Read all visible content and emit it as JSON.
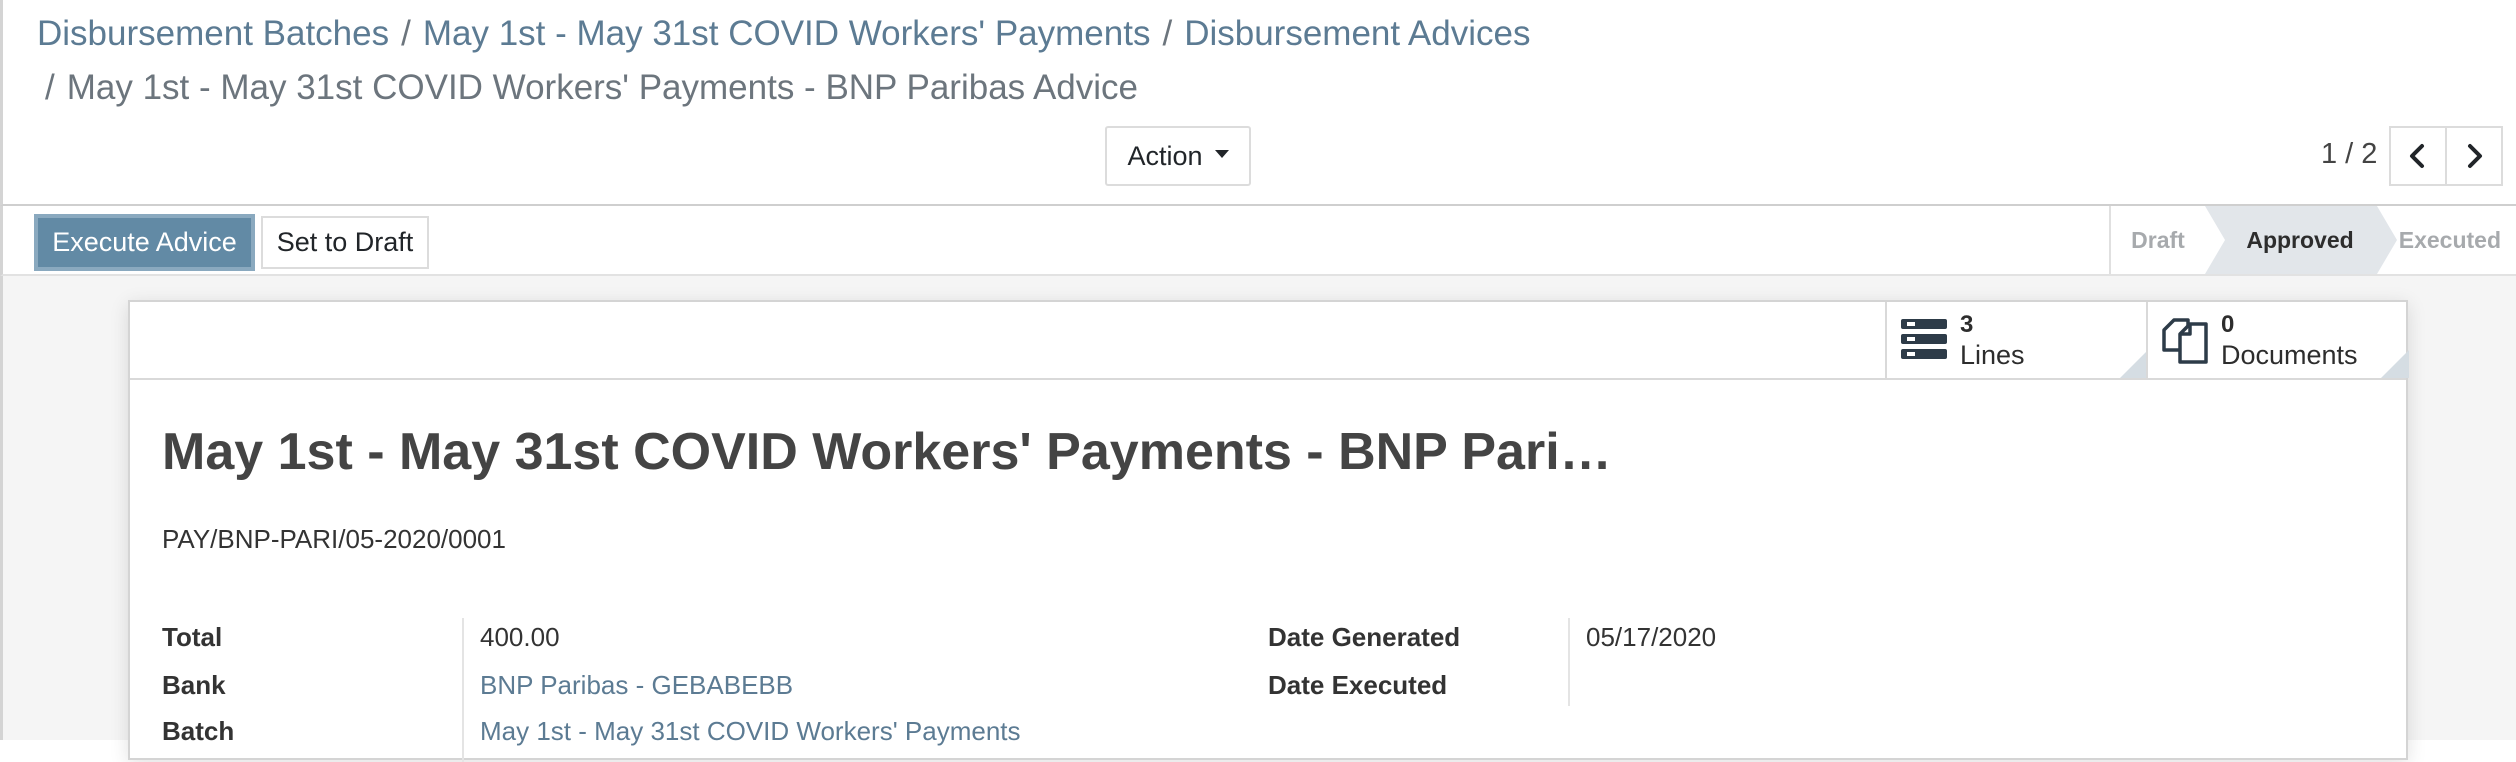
{
  "breadcrumb": {
    "items": [
      "Disbursement Batches",
      "May 1st - May 31st COVID Workers' Payments",
      "Disbursement Advices"
    ],
    "separator": "/",
    "current": "May 1st - May 31st COVID Workers' Payments - BNP Paribas Advice"
  },
  "toolbar": {
    "action_label": "Action",
    "pager": "1 / 2"
  },
  "statusbar": {
    "execute_label": "Execute Advice",
    "draft_label": "Set to Draft",
    "stages": [
      "Draft",
      "Approved",
      "Executed"
    ],
    "active_stage": "Approved"
  },
  "smart_buttons": {
    "lines": {
      "count": "3",
      "label": "Lines",
      "icon": "list-icon"
    },
    "documents": {
      "count": "0",
      "label": "Documents",
      "icon": "documents-icon"
    }
  },
  "record": {
    "title": "May 1st - May 31st COVID Workers' Payments - BNP Pari…",
    "reference": "PAY/BNP-PARI/05-2020/0001",
    "fields_left": [
      {
        "label": "Total",
        "value": "400.00"
      },
      {
        "label": "Bank",
        "value": "BNP Paribas - GEBABEBB"
      },
      {
        "label": "Batch",
        "value": "May 1st - May 31st COVID Workers' Payments"
      }
    ],
    "fields_right": [
      {
        "label": "Date Generated",
        "value": "05/17/2020"
      },
      {
        "label": "Date Executed",
        "value": ""
      }
    ]
  },
  "colors": {
    "primary": "#628aa5",
    "link": "#5c7b93",
    "active_stage_bg": "#e2e6ea"
  }
}
